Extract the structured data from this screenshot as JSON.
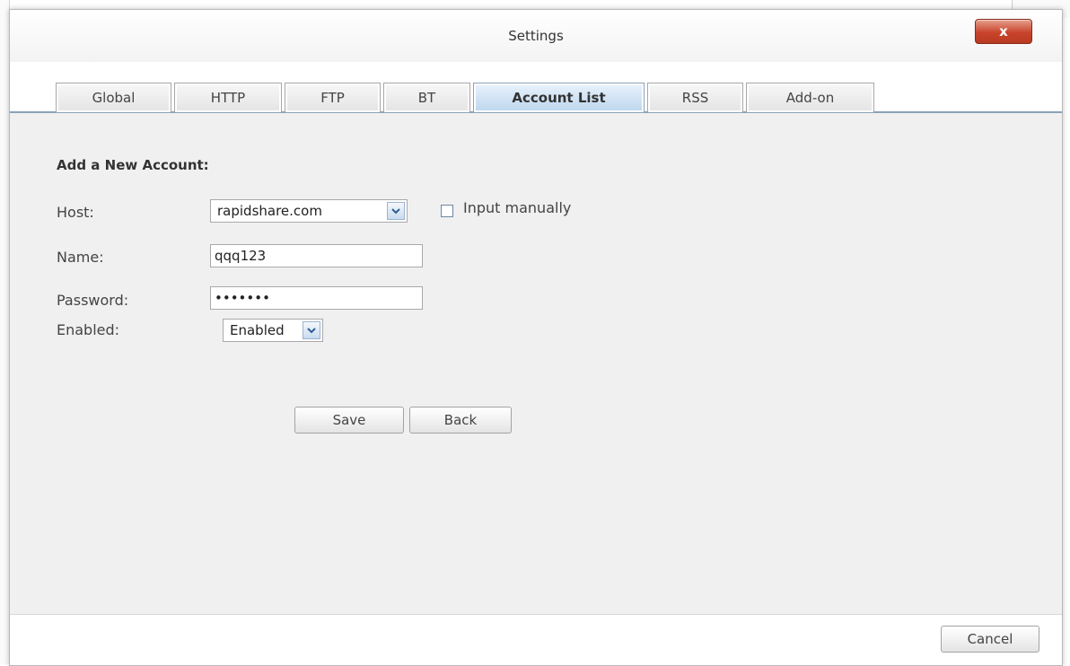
{
  "dialog": {
    "title": "Settings",
    "close_label": "x"
  },
  "tabs": [
    {
      "label": "Global",
      "active": false
    },
    {
      "label": "HTTP",
      "active": false
    },
    {
      "label": "FTP",
      "active": false
    },
    {
      "label": "BT",
      "active": false
    },
    {
      "label": "Account List",
      "active": true
    },
    {
      "label": "RSS",
      "active": false
    },
    {
      "label": "Add-on",
      "active": false
    }
  ],
  "form": {
    "section_title": "Add a New Account:",
    "host_label": "Host:",
    "host_value": "rapidshare.com",
    "input_manually_label": "Input manually",
    "input_manually_checked": false,
    "name_label": "Name:",
    "name_value": "qqq123",
    "password_label": "Password:",
    "password_value": "•••••••",
    "enabled_label": "Enabled:",
    "enabled_value": "Enabled",
    "save_label": "Save",
    "back_label": "Back"
  },
  "footer": {
    "cancel_label": "Cancel"
  },
  "colors": {
    "active_tab": "#bcd6ee",
    "close_button": "#c9442b",
    "tab_underline": "#8ba2b8"
  }
}
